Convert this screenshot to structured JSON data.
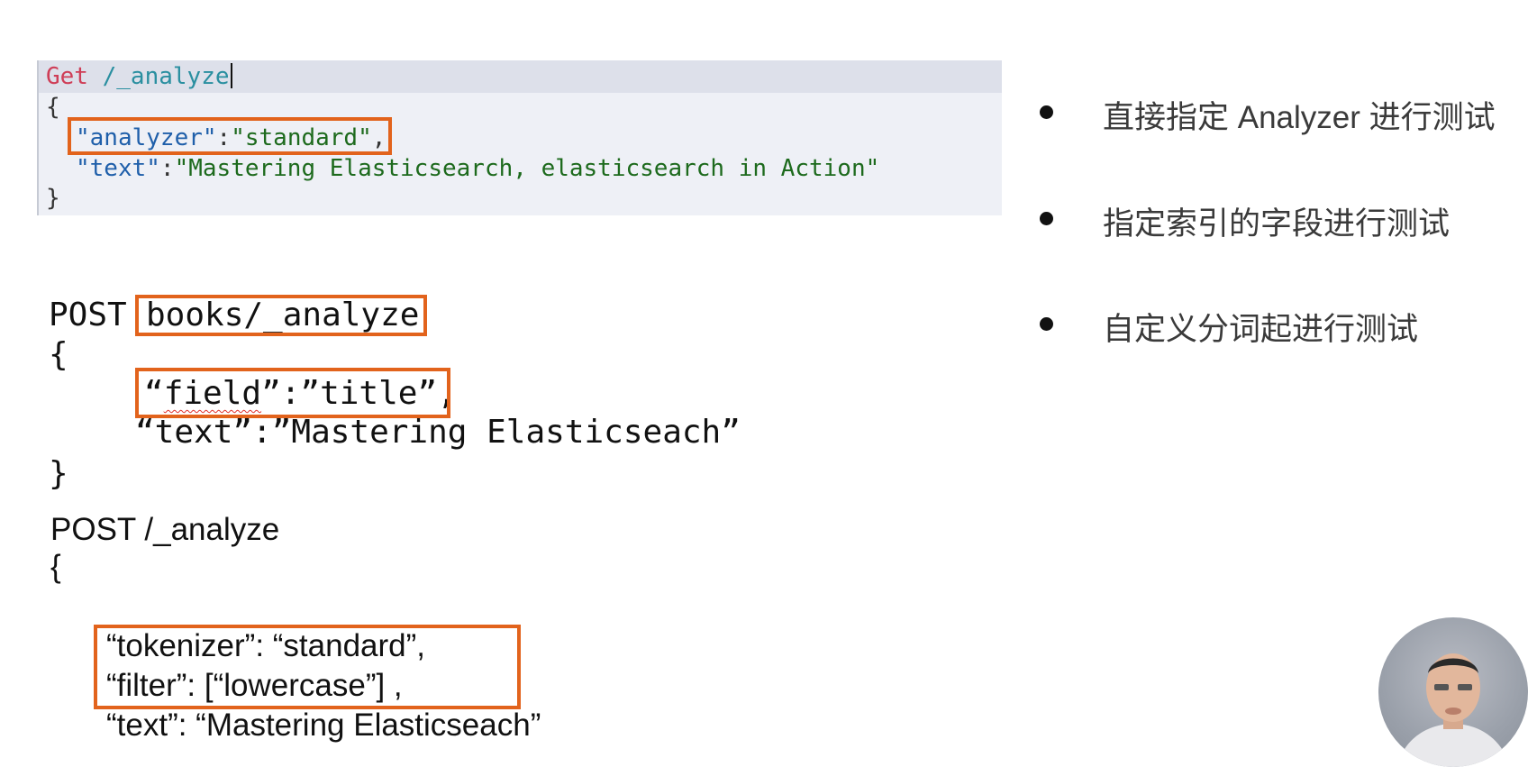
{
  "request1": {
    "line1_method": "Get",
    "line1_path": "/_analyze",
    "open_brace": "{",
    "analyzer_key": "\"analyzer\"",
    "colon": ":",
    "analyzer_value": "\"standard\"",
    "comma": ",",
    "text_key": "\"text\"",
    "text_value": "\"Mastering Elasticsearch, elasticsearch in Action\"",
    "close_brace": "}"
  },
  "request2": {
    "method": "POST",
    "path": "books/_analyze",
    "open_brace": "{",
    "field_open": "“",
    "field_word": "field",
    "field_rest": "”:”title”,",
    "text_line": "“text”:”Mastering Elasticseach”",
    "close_brace": "}"
  },
  "request3": {
    "line1": "POST /_analyze",
    "open_brace": "{",
    "tokenizer_line": "“tokenizer”: “standard”,",
    "filter_line": "“filter”: [“lowercase”] ,",
    "text_line": "“text”: “Mastering Elasticseach”"
  },
  "bullets": [
    {
      "label": "直接指定 Analyzer 进行测试"
    },
    {
      "label": "指定索引的字段进行测试"
    },
    {
      "label": "自定义分词起进行测试"
    }
  ],
  "colors": {
    "highlight": "#e2631c",
    "code_bg": "#eef0f6"
  }
}
